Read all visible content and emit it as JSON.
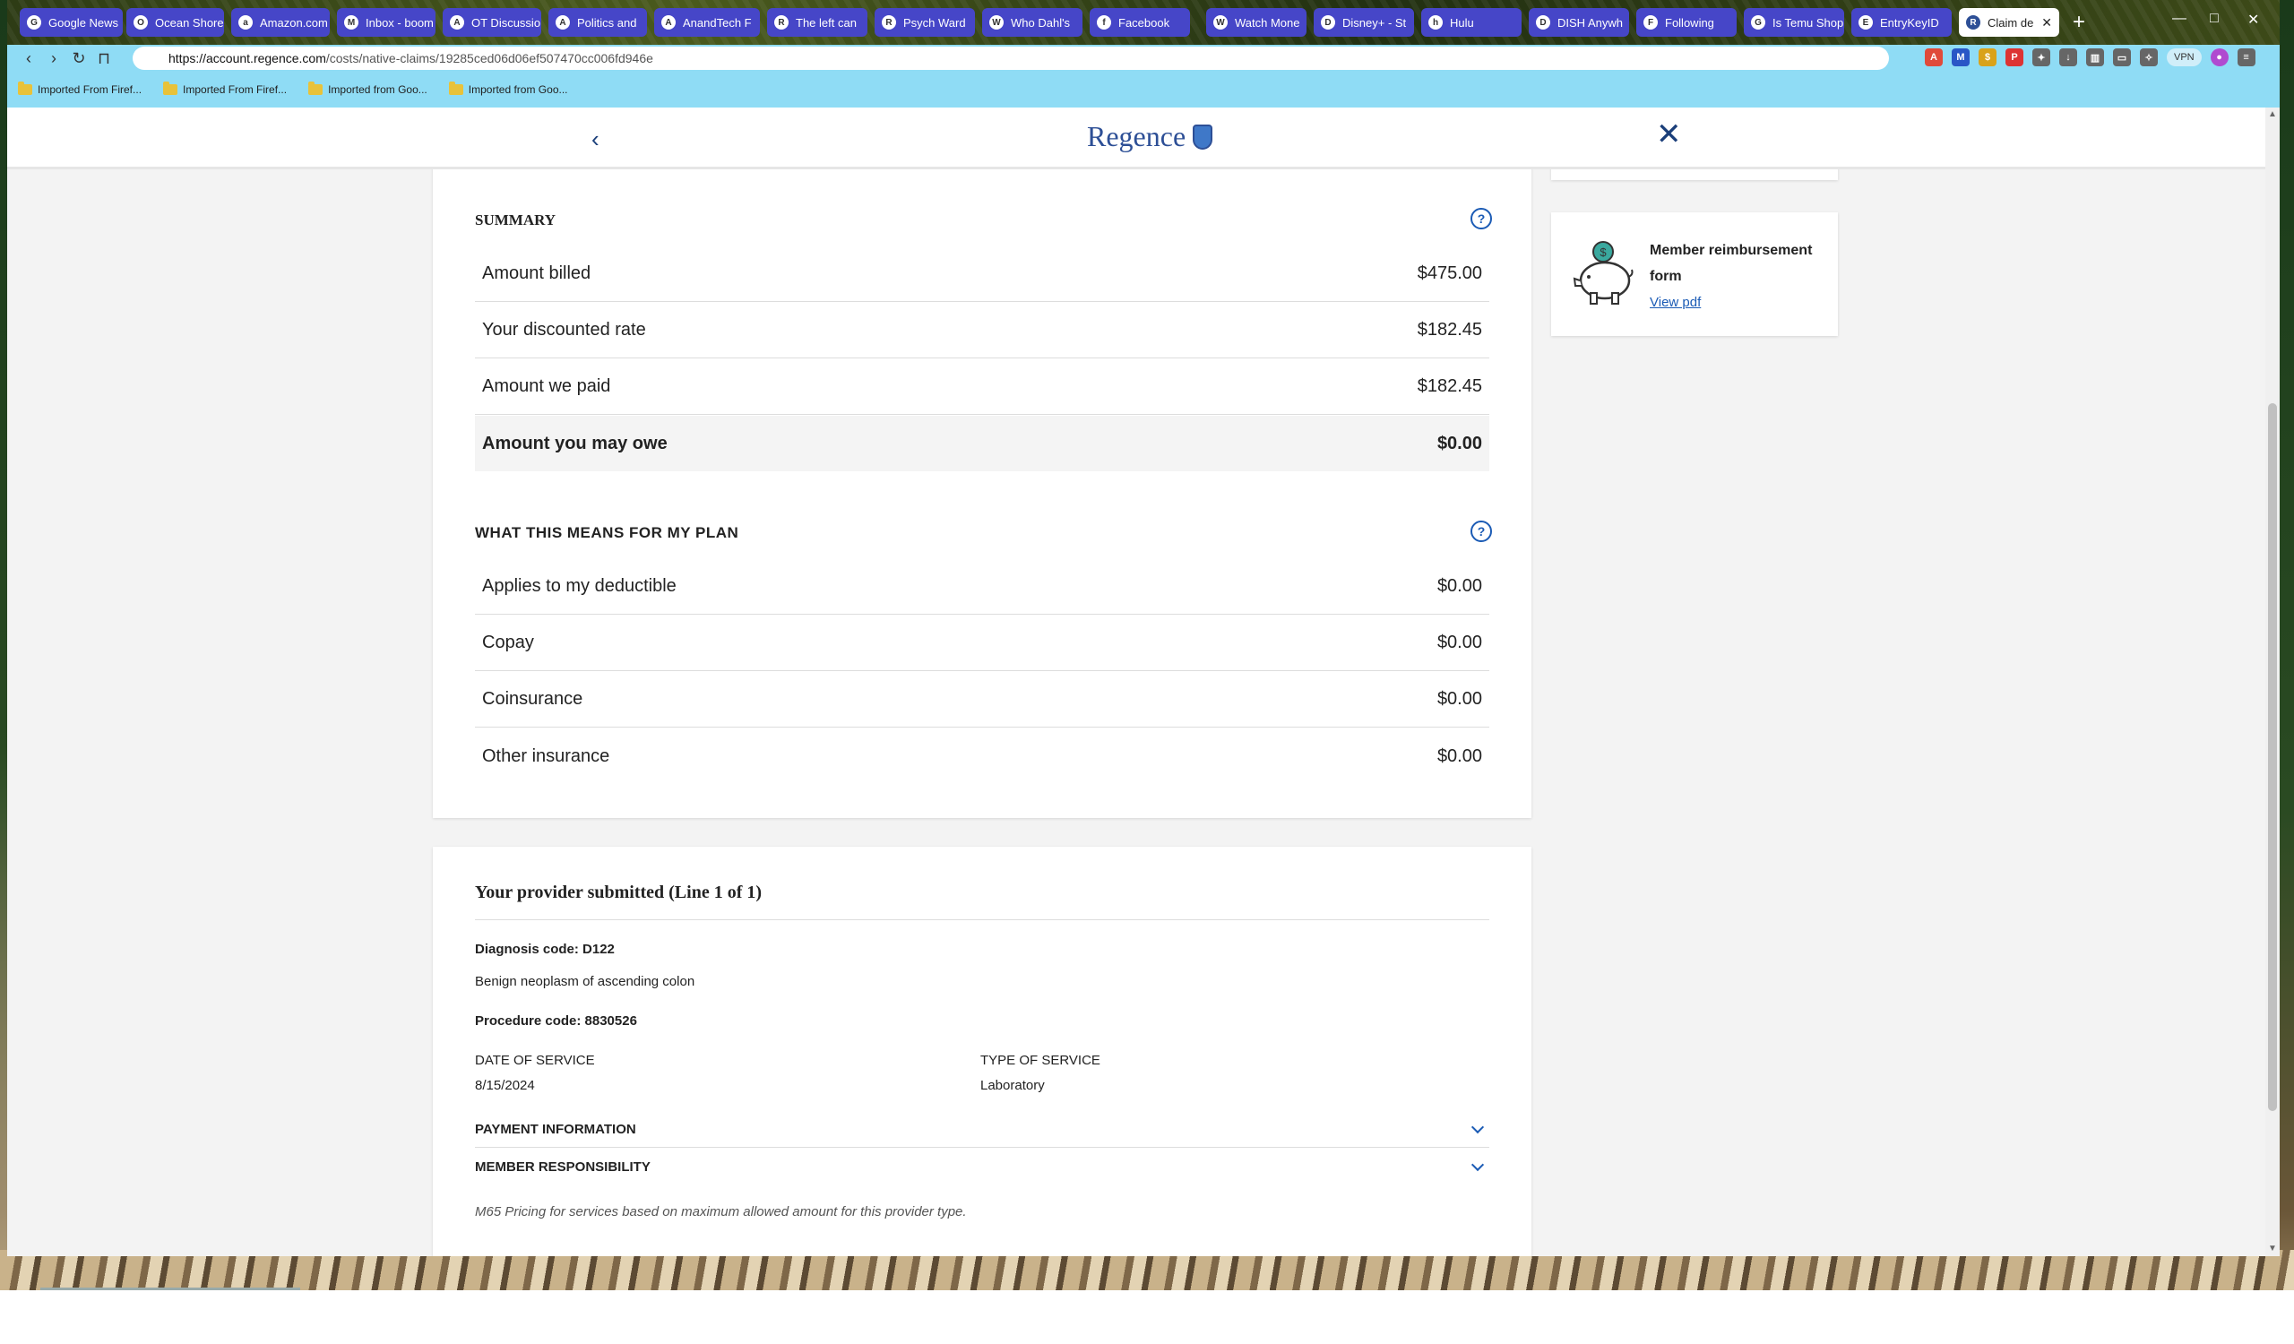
{
  "browser": {
    "tabs": [
      {
        "label": "Google News",
        "fav": "G"
      },
      {
        "label": "Ocean Shores",
        "fav": "O"
      },
      {
        "label": "Amazon.com",
        "fav": "a"
      },
      {
        "label": "Inbox - boom",
        "fav": "M"
      },
      {
        "label": "OT Discussio",
        "fav": "A"
      },
      {
        "label": "Politics and",
        "fav": "A"
      },
      {
        "label": "AnandTech F",
        "fav": "A"
      },
      {
        "label": "The left can",
        "fav": "R"
      },
      {
        "label": "Psych Ward",
        "fav": "R"
      },
      {
        "label": "Who Dahl's",
        "fav": "W"
      },
      {
        "label": "Facebook",
        "fav": "f"
      },
      {
        "label": "Watch Mone",
        "fav": "W"
      },
      {
        "label": "Disney+ - St",
        "fav": "D"
      },
      {
        "label": "Hulu",
        "fav": "h"
      },
      {
        "label": "DISH Anywh",
        "fav": "D"
      },
      {
        "label": "Following",
        "fav": "F"
      },
      {
        "label": "Is Temu Shop",
        "fav": "G"
      },
      {
        "label": "EntryKeyID",
        "fav": "E"
      },
      {
        "label": "Claim de",
        "fav": "R"
      }
    ],
    "url_domain": "https://account.regence.com",
    "url_path": "/costs/native-claims/19285ced06d06ef507470cc006fd946e",
    "bookmarks": [
      "Imported From Firef...",
      "Imported From Firef...",
      "Imported from Goo...",
      "Imported from Goo..."
    ],
    "vpn_label": "VPN",
    "window_controls": {
      "minimize": "—",
      "restore": "□",
      "close": "✕"
    }
  },
  "site": {
    "logo_text": "Regence",
    "back_glyph": "‹",
    "close_glyph": "✕"
  },
  "summary": {
    "title": "SUMMARY",
    "rows": [
      {
        "label": "Amount billed",
        "value": "$475.00"
      },
      {
        "label": "Your discounted rate",
        "value": "$182.45"
      },
      {
        "label": "Amount we paid",
        "value": "$182.45"
      },
      {
        "label": "Amount you may owe",
        "value": "$0.00"
      }
    ]
  },
  "plan": {
    "title": "WHAT THIS MEANS FOR MY PLAN",
    "rows": [
      {
        "label": "Applies to my deductible",
        "value": "$0.00"
      },
      {
        "label": "Copay",
        "value": "$0.00"
      },
      {
        "label": "Coinsurance",
        "value": "$0.00"
      },
      {
        "label": "Other insurance",
        "value": "$0.00"
      }
    ]
  },
  "provider": {
    "title": "Your provider submitted (Line 1 of 1)",
    "diagnosis": "Diagnosis code: D122",
    "diagnosis_desc": "Benign neoplasm of ascending colon",
    "procedure": "Procedure code: 8830526",
    "date_label": "DATE OF SERVICE",
    "date_value": "8/15/2024",
    "type_label": "TYPE OF SERVICE",
    "type_value": "Laboratory",
    "payment_info": "PAYMENT INFORMATION",
    "member_resp": "MEMBER RESPONSIBILITY",
    "note": "M65 Pricing for services based on maximum allowed amount for this provider type."
  },
  "sidebar": {
    "reimburse_title": "Member reimbursement form",
    "reimburse_link": "View pdf"
  },
  "colors": {
    "accent": "#1b5bb5",
    "brand": "#2d4f96",
    "tab_bg": "#4646c8",
    "toolbar_bg": "#8fdcf5"
  }
}
